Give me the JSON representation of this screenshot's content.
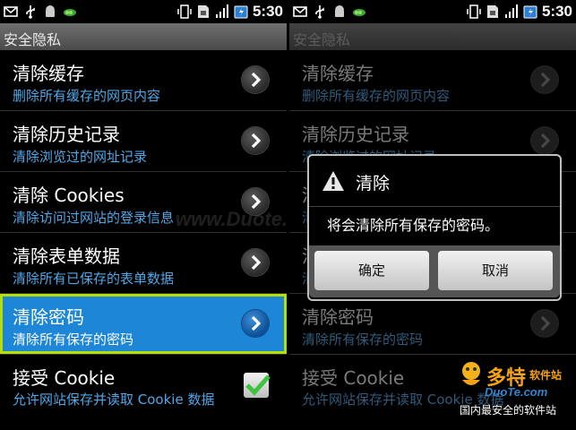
{
  "status_bar": {
    "time": "5:30"
  },
  "screen_title": "安全隐私",
  "items": [
    {
      "title": "清除缓存",
      "subtitle": "删除所有缓存的网页内容"
    },
    {
      "title": "清除历史记录",
      "subtitle": "清除浏览过的网址记录"
    },
    {
      "title": "清除 Cookies",
      "subtitle": "清除访问过网站的登录信息"
    },
    {
      "title": "清除表单数据",
      "subtitle": "清除所有已保存的表单数据"
    },
    {
      "title": "清除密码",
      "subtitle": "清除所有保存的密码"
    },
    {
      "title": "接受 Cookie",
      "subtitle": "允许网站保存并读取 Cookie 数据",
      "checked": true
    }
  ],
  "dialog": {
    "title": "清除",
    "message": "将会清除所有保存的密码。",
    "ok_label": "确定",
    "cancel_label": "取消"
  },
  "watermark": "www.Duote.com",
  "logo": {
    "brand": "多特",
    "brand_small": "软件站",
    "url": "DuoTe.com",
    "tagline": "国内最安全的软件站"
  },
  "colors": {
    "accent": "#1d86d6",
    "selection_border": "#b7e000",
    "subtitle": "#4fa7e8"
  }
}
